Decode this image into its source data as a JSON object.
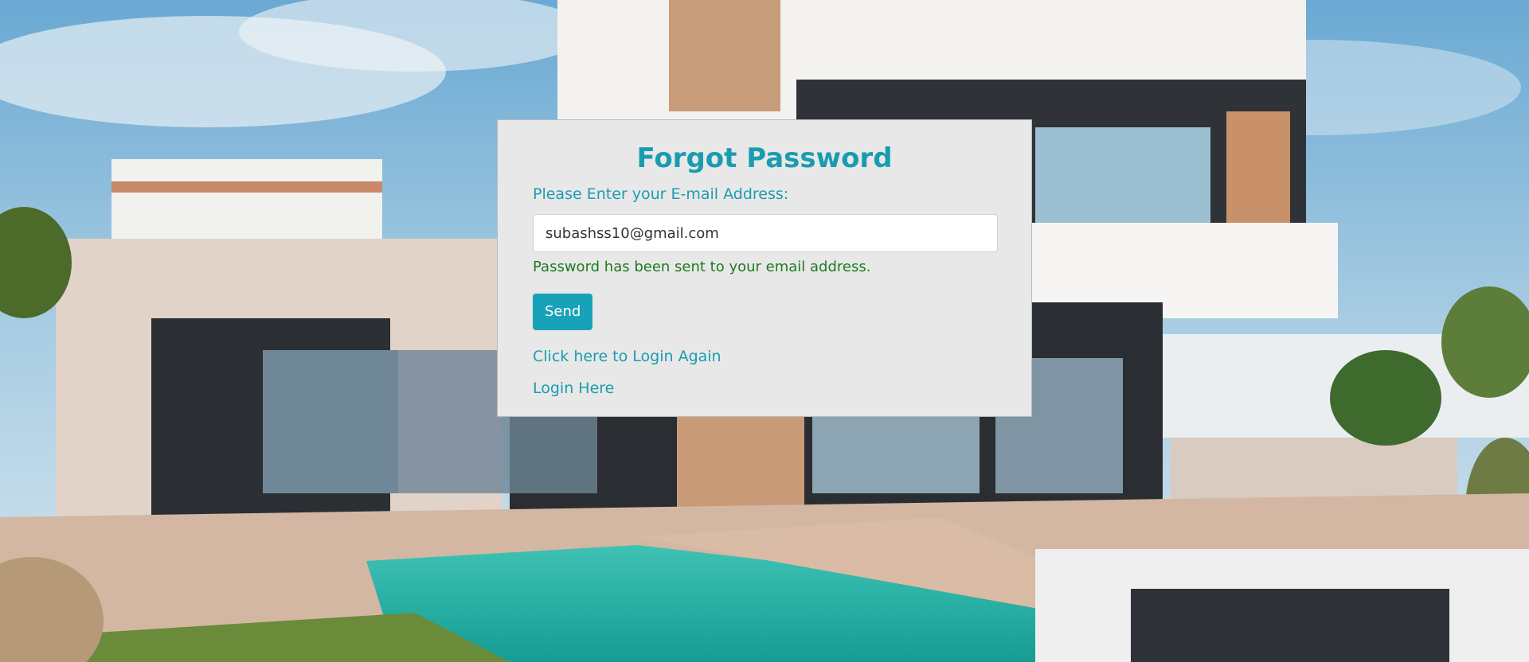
{
  "form": {
    "title": "Forgot Password",
    "prompt": "Please Enter your E-mail Address:",
    "email_value": "subashss10@gmail.com",
    "success_message": "Password has been sent to your email address.",
    "send_label": "Send",
    "login_again_link": "Click here to Login Again",
    "login_here_link": "Login Here"
  },
  "colors": {
    "accent": "#17a2b8",
    "success": "#1f7a1f",
    "card_bg": "#e8e8e8"
  }
}
